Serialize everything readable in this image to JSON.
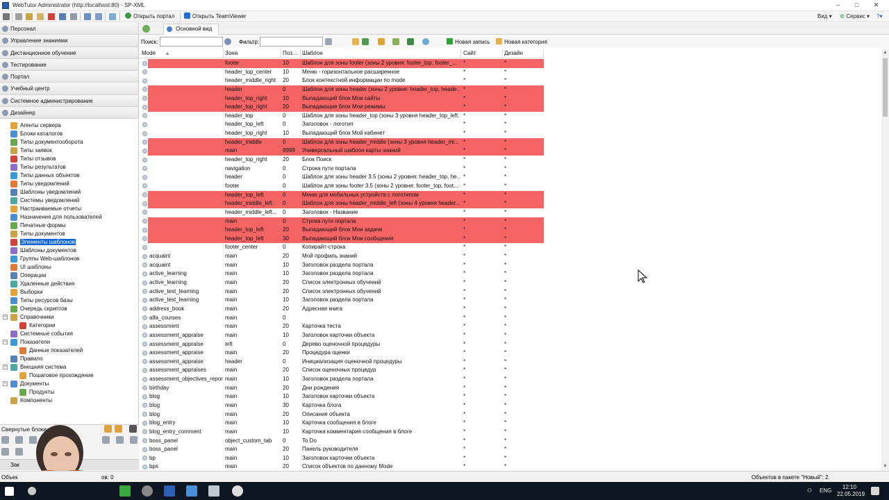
{
  "window": {
    "title": "WebTutor Administrator (http://localhost:80) - SP-XML",
    "controls": [
      "–",
      "□",
      "✕"
    ]
  },
  "toolbar": {
    "open_portal": "Открыть портал",
    "open_teamviewer": "Открыть TeamViewer",
    "view_menu": "Вид",
    "service_menu": "Сервис"
  },
  "sidebar": {
    "sections": [
      "Персонал",
      "Управление знаниями",
      "Дистанционное обучение",
      "Тестирование",
      "Портал",
      "Учебный центр",
      "Системное администрирование",
      "Дизайнер"
    ],
    "tree": [
      {
        "label": "Агенты сервера",
        "level": 1
      },
      {
        "label": "Блоки каталогов",
        "level": 1
      },
      {
        "label": "Типы документооборота",
        "level": 1
      },
      {
        "label": "Типы заявок",
        "level": 1
      },
      {
        "label": "Типы отзывов",
        "level": 1
      },
      {
        "label": "Типы результатов",
        "level": 1
      },
      {
        "label": "Типы данных объектов",
        "level": 1
      },
      {
        "label": "Типы уведомлений",
        "level": 1
      },
      {
        "label": "Шаблоны уведомлений",
        "level": 1
      },
      {
        "label": "Системы уведомлений",
        "level": 1
      },
      {
        "label": "Настраиваемые отчеты",
        "level": 1
      },
      {
        "label": "Назначения для пользователей",
        "level": 1
      },
      {
        "label": "Печатные формы",
        "level": 1
      },
      {
        "label": "Типы документов",
        "level": 1
      },
      {
        "label": "Элементы шаблонов",
        "level": 1,
        "selected": true
      },
      {
        "label": "Шаблоны документов",
        "level": 1
      },
      {
        "label": "Группы Web-шаблонов",
        "level": 1
      },
      {
        "label": "UI шаблоны",
        "level": 1
      },
      {
        "label": "Операции",
        "level": 1
      },
      {
        "label": "Удаленные действия",
        "level": 1
      },
      {
        "label": "Выборки",
        "level": 1
      },
      {
        "label": "Типы ресурсов базы",
        "level": 1
      },
      {
        "label": "Очередь скриптов",
        "level": 1
      },
      {
        "label": "Справочники",
        "level": 1,
        "expander": "−"
      },
      {
        "label": "Категории",
        "level": 2
      },
      {
        "label": "Системные события",
        "level": 1
      },
      {
        "label": "Показатели",
        "level": 1,
        "expander": "−"
      },
      {
        "label": "Данные показателей",
        "level": 2
      },
      {
        "label": "Правило",
        "level": 1
      },
      {
        "label": "Внешняя система",
        "level": 1,
        "expander": "−"
      },
      {
        "label": "Пошаговое прохождение",
        "level": 2
      },
      {
        "label": "Документы",
        "level": 1,
        "expander": "−"
      },
      {
        "label": "Продукты",
        "level": 2
      },
      {
        "label": "Компоненты",
        "level": 1
      }
    ],
    "collapsed_blocks_label": "Свернутые блоки:",
    "bottom_tab": "Зак"
  },
  "tabs": [
    {
      "label": "Основной вид",
      "active": true
    }
  ],
  "search": {
    "label": "Поиск:",
    "value": ""
  },
  "filter": {
    "label": "Фильтр:",
    "value": ""
  },
  "actions": {
    "new_record": "Новая запись",
    "new_category": "Новая категория"
  },
  "table": {
    "columns": [
      "Mode",
      "Зона",
      "Поз...",
      "Шаблон",
      "Сайт",
      "Дизайн"
    ],
    "rows": [
      {
        "mode": "",
        "zone": "footer",
        "pos": "10",
        "template": "Шаблон для зоны footer (зоны 2 уровня: footer_top, footer_...",
        "site": "*",
        "design": "*",
        "hl": true
      },
      {
        "mode": "",
        "zone": "header_top_center",
        "pos": "10",
        "template": "Меню - горизонтальное расширенное",
        "site": "*",
        "design": "*",
        "hl": false
      },
      {
        "mode": "",
        "zone": "header_middle_right",
        "pos": "20",
        "template": "Блок контекстной информации по mode",
        "site": "*",
        "design": "*",
        "hl": false
      },
      {
        "mode": "",
        "zone": "header",
        "pos": "0",
        "template": "Шаблон для зоны header (зоны 2 уровня: header_top, heade...",
        "site": "*",
        "design": "*",
        "hl": true
      },
      {
        "mode": "",
        "zone": "header_top_right",
        "pos": "10",
        "template": "Выпадающий блок Мои сайты",
        "site": "*",
        "design": "*",
        "hl": true
      },
      {
        "mode": "",
        "zone": "header_top_right",
        "pos": "20",
        "template": "Выпадающие блок Мои режимы",
        "site": "*",
        "design": "*",
        "hl": true
      },
      {
        "mode": "",
        "zone": "header_top",
        "pos": "0",
        "template": "Шаблон для зоны header_top (зоны 3 уровня header_top_left...",
        "site": "*",
        "design": "*",
        "hl": false
      },
      {
        "mode": "",
        "zone": "header_top_left",
        "pos": "0",
        "template": "Заголовок - логотип",
        "site": "*",
        "design": "*",
        "hl": false
      },
      {
        "mode": "",
        "zone": "header_top_right",
        "pos": "10",
        "template": "Выпадающий блок Мой кабинет",
        "site": "*",
        "design": "*",
        "hl": false
      },
      {
        "mode": "",
        "zone": "header_middle",
        "pos": "0",
        "template": "Шаблон для зоны header_middle (зоны 3 уровня header_mi...",
        "site": "*",
        "design": "*",
        "hl": true
      },
      {
        "mode": "",
        "zone": "main",
        "pos": "9999",
        "template": "Универсальный шаблон карты знаний",
        "site": "*",
        "design": "*",
        "hl": true
      },
      {
        "mode": "",
        "zone": "header_top_right",
        "pos": "20",
        "template": "Блок Поиск",
        "site": "*",
        "design": "*",
        "hl": false
      },
      {
        "mode": "",
        "zone": "navigation",
        "pos": "0",
        "template": "Строка пути портала",
        "site": "*",
        "design": "*",
        "hl": false
      },
      {
        "mode": "",
        "zone": "header",
        "pos": "0",
        "template": "Шаблон для зоны header 3.5 (зоны 2 уровня: header_top, he...",
        "site": "*",
        "design": "*",
        "hl": false
      },
      {
        "mode": "",
        "zone": "footer",
        "pos": "0",
        "template": "Шаблон для зоны footer 3.5 (зоны 2 уровня: footer_top, foot...",
        "site": "*",
        "design": "*",
        "hl": false
      },
      {
        "mode": "",
        "zone": "header_top_left",
        "pos": "0",
        "template": "Меню для мобильных устройств с логотипом",
        "site": "*",
        "design": "*",
        "hl": true
      },
      {
        "mode": "",
        "zone": "header_middle_left",
        "pos": "0",
        "template": "Шаблон для зоны header_middle_left (зоны 4 уровня header...",
        "site": "*",
        "design": "*",
        "hl": true
      },
      {
        "mode": "",
        "zone": "header_middle_left...",
        "pos": "0",
        "template": "Заголовок - Название",
        "site": "*",
        "design": "*",
        "hl": false
      },
      {
        "mode": "",
        "zone": "main",
        "pos": "0",
        "template": "Строка пути портала",
        "site": "*",
        "design": "*",
        "hl": true
      },
      {
        "mode": "",
        "zone": "header_top_left",
        "pos": "20",
        "template": "Выпадающий блок Мои задачи",
        "site": "*",
        "design": "*",
        "hl": true
      },
      {
        "mode": "",
        "zone": "header_top_left",
        "pos": "30",
        "template": "Выпадающий блок Мои сообщения",
        "site": "*",
        "design": "*",
        "hl": true
      },
      {
        "mode": "",
        "zone": "footer_center",
        "pos": "0",
        "template": "Копирайт-строка",
        "site": "*",
        "design": "*",
        "hl": false
      },
      {
        "mode": "acquaint",
        "zone": "main",
        "pos": "20",
        "template": "Мой профиль знаний",
        "site": "*",
        "design": "*",
        "hl": false
      },
      {
        "mode": "acquaint",
        "zone": "main",
        "pos": "10",
        "template": "Заголовок раздела портала",
        "site": "*",
        "design": "*",
        "hl": false
      },
      {
        "mode": "active_learning",
        "zone": "main",
        "pos": "10",
        "template": "Заголовок раздела портала",
        "site": "*",
        "design": "*",
        "hl": false
      },
      {
        "mode": "active_learning",
        "zone": "main",
        "pos": "20",
        "template": "Список электронных обучений",
        "site": "*",
        "design": "*",
        "hl": false
      },
      {
        "mode": "active_test_learning",
        "zone": "main",
        "pos": "20",
        "template": "Список электронных обучений",
        "site": "*",
        "design": "*",
        "hl": false
      },
      {
        "mode": "active_test_learning",
        "zone": "main",
        "pos": "10",
        "template": "Заголовок раздела портала",
        "site": "*",
        "design": "*",
        "hl": false
      },
      {
        "mode": "address_book",
        "zone": "main",
        "pos": "20",
        "template": "Адресная книга",
        "site": "*",
        "design": "*",
        "hl": false
      },
      {
        "mode": "alfa_courses",
        "zone": "main",
        "pos": "0",
        "template": "",
        "site": "*",
        "design": "*",
        "hl": false
      },
      {
        "mode": "assessment",
        "zone": "main",
        "pos": "20",
        "template": "Карточка теста",
        "site": "*",
        "design": "*",
        "hl": false
      },
      {
        "mode": "assessment_appraise",
        "zone": "main",
        "pos": "10",
        "template": "Заголовок карточки объекта",
        "site": "*",
        "design": "*",
        "hl": false
      },
      {
        "mode": "assessment_appraise",
        "zone": "left",
        "pos": "0",
        "template": "Дерево оценочной процедуры",
        "site": "*",
        "design": "*",
        "hl": false
      },
      {
        "mode": "assessment_appraise",
        "zone": "main",
        "pos": "20",
        "template": "Процедура оценки",
        "site": "*",
        "design": "*",
        "hl": false
      },
      {
        "mode": "assessment_appraise",
        "zone": "header",
        "pos": "0",
        "template": "Инициализация оценочной процедуры",
        "site": "*",
        "design": "*",
        "hl": false
      },
      {
        "mode": "assessment_appraises",
        "zone": "main",
        "pos": "20",
        "template": "Список оценочных процедур",
        "site": "*",
        "design": "*",
        "hl": false
      },
      {
        "mode": "assessment_objectives_report",
        "zone": "main",
        "pos": "10",
        "template": "Заголовок раздела портала",
        "site": "*",
        "design": "*",
        "hl": false
      },
      {
        "mode": "birthday",
        "zone": "main",
        "pos": "20",
        "template": "Дни рождения",
        "site": "*",
        "design": "*",
        "hl": false
      },
      {
        "mode": "blog",
        "zone": "main",
        "pos": "10",
        "template": "Заголовок карточки объекта",
        "site": "*",
        "design": "*",
        "hl": false
      },
      {
        "mode": "blog",
        "zone": "main",
        "pos": "30",
        "template": "Карточка блога",
        "site": "*",
        "design": "*",
        "hl": false
      },
      {
        "mode": "blog",
        "zone": "main",
        "pos": "20",
        "template": "Описание объекта",
        "site": "*",
        "design": "*",
        "hl": false
      },
      {
        "mode": "blog_entry",
        "zone": "main",
        "pos": "10",
        "template": "Карточка сообщения в блоге",
        "site": "*",
        "design": "*",
        "hl": false
      },
      {
        "mode": "blog_entry_comment",
        "zone": "main",
        "pos": "10",
        "template": "Карточка комментария сообщения в блоге",
        "site": "*",
        "design": "*",
        "hl": false
      },
      {
        "mode": "boss_panel",
        "zone": "object_custom_tab",
        "pos": "0",
        "template": "To Do",
        "site": "*",
        "design": "*",
        "hl": false
      },
      {
        "mode": "boss_panel",
        "zone": "main",
        "pos": "20",
        "template": "Панель руководителя",
        "site": "*",
        "design": "*",
        "hl": false
      },
      {
        "mode": "bp",
        "zone": "main",
        "pos": "10",
        "template": "Заголовок карточки объекта",
        "site": "*",
        "design": "*",
        "hl": false
      },
      {
        "mode": "bps",
        "zone": "main",
        "pos": "20",
        "template": "Список объектов по данному Mode",
        "site": "*",
        "design": "*",
        "hl": false
      }
    ]
  },
  "status": {
    "left": "Объек",
    "mid": "ов: 0",
    "right": "Объектов в пакете \"Новый\": 2."
  },
  "taskbar": {
    "lang": "ENG",
    "time": "12:10",
    "date": "22.05.2019"
  },
  "colors": {
    "highlight": "#f46464",
    "selection": "#0a64d8",
    "taskbar": "#0e1621"
  }
}
